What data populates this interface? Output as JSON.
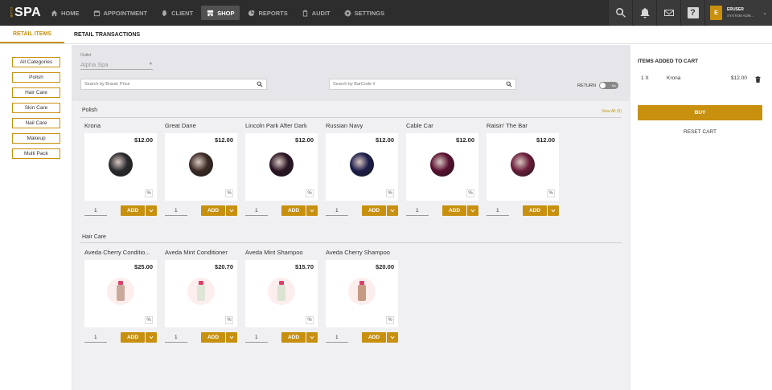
{
  "app": {
    "logo_prefix": "CLUB",
    "logo": "SPA"
  },
  "nav": [
    {
      "label": "HOME",
      "icon": "home-icon",
      "active": false
    },
    {
      "label": "APPOINTMENT",
      "icon": "calendar-icon",
      "active": false
    },
    {
      "label": "CLIENT",
      "icon": "client-icon",
      "active": false
    },
    {
      "label": "SHOP",
      "icon": "shop-icon",
      "active": true
    },
    {
      "label": "REPORTS",
      "icon": "pie-chart-icon",
      "active": false
    },
    {
      "label": "AUDIT",
      "icon": "clipboard-icon",
      "active": false
    },
    {
      "label": "SETTINGS",
      "icon": "gear-icon",
      "active": false
    }
  ],
  "user": {
    "initial": "E",
    "name": "ERUSER",
    "role": "SYSTEM ADM..."
  },
  "tabs": {
    "retail_items": "RETAIL ITEMS",
    "retail_transactions": "RETAIL TRANSACTIONS"
  },
  "categories": [
    "All Categories",
    "Polish",
    "Hair Care",
    "Skin Care",
    "Nail Care",
    "Makeup",
    "Multi Pack"
  ],
  "filters": {
    "outlet_label": "Outlet",
    "outlet_value": "Alpha Spa",
    "search_brand_placeholder": "Search by Brand, Price",
    "search_barcode_placeholder": "Search by BarCode #",
    "return_label": "RETURN",
    "return_toggle": "No"
  },
  "sections": [
    {
      "title": "Polish",
      "view_all": "View All (6)",
      "products": [
        {
          "name": "Krona",
          "price": "$12.00",
          "qty": "1",
          "color": "#2a2a2e"
        },
        {
          "name": "Great Dane",
          "price": "$12.00",
          "qty": "1",
          "color": "#3b2a24"
        },
        {
          "name": "Lincoln Park After Dark",
          "price": "$12.00",
          "qty": "1",
          "color": "#2b1524"
        },
        {
          "name": "Russian Navy",
          "price": "$12.00",
          "qty": "1",
          "color": "#1c1d4a"
        },
        {
          "name": "Cable Car",
          "price": "$12.00",
          "qty": "1",
          "color": "#5a1030"
        },
        {
          "name": "Raisin' The Bar",
          "price": "$12.00",
          "qty": "1",
          "color": "#6a1d3a"
        }
      ]
    },
    {
      "title": "Hair Care",
      "view_all": "",
      "products": [
        {
          "name": "Aveda Cherry Conditio...",
          "price": "$25.00",
          "qty": "1",
          "color": "#c9a99a"
        },
        {
          "name": "Aveda Mint Conditioner",
          "price": "$20.70",
          "qty": "1",
          "color": "#dfe6d8"
        },
        {
          "name": "Aveda Mint Shampoo",
          "price": "$15.70",
          "qty": "1",
          "color": "#dbe3d2"
        },
        {
          "name": "Aveda Cherry Shampoo",
          "price": "$20.00",
          "qty": "1",
          "color": "#c79a84"
        }
      ]
    }
  ],
  "labels": {
    "add": "ADD",
    "percent": "%"
  },
  "cart": {
    "title": "ITEMS ADDED TO CART",
    "items": [
      {
        "qty": "1 X",
        "name": "Krona",
        "price": "$12.00"
      }
    ],
    "buy": "BUY",
    "reset": "RESET CART"
  },
  "colors": {
    "accent": "#c8900f",
    "topbar": "#2d2d2d"
  }
}
